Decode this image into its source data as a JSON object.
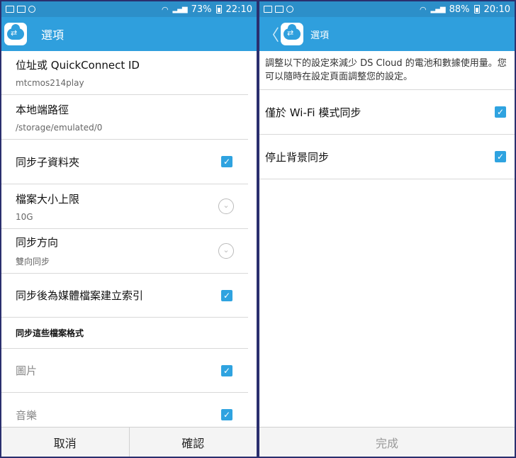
{
  "left": {
    "status": {
      "battery": "73%",
      "time": "22:10"
    },
    "appbar": {
      "title": "選項"
    },
    "items": [
      {
        "title": "位址或 QuickConnect ID",
        "sub": "mtcmos214play"
      },
      {
        "title": "本地端路徑",
        "sub": "/storage/emulated/0"
      },
      {
        "title": "同步子資料夾"
      },
      {
        "title": "檔案大小上限",
        "sub": "10G"
      },
      {
        "title": "同步方向",
        "sub": "雙向同步"
      },
      {
        "title": "同步後為媒體檔案建立索引"
      }
    ],
    "section_header": "同步這些檔案格式",
    "format_items": [
      {
        "title": "圖片"
      },
      {
        "title": "音樂"
      }
    ],
    "footer": {
      "cancel": "取消",
      "confirm": "確認"
    }
  },
  "right": {
    "status": {
      "battery": "88%",
      "time": "20:10"
    },
    "appbar": {
      "title": "選項"
    },
    "description": "調整以下的設定來減少 DS Cloud 的電池和數據使用量。您可以隨時在設定頁面調整您的設定。",
    "items": [
      {
        "title": "僅於 Wi-Fi 模式同步"
      },
      {
        "title": "停止背景同步"
      }
    ],
    "footer": {
      "done": "完成"
    }
  },
  "colors": {
    "accent": "#2f9fdd",
    "statusbar": "#2c8fc9",
    "checkbox": "#2fa3e0"
  },
  "icons": {
    "check": "✓",
    "chevron_down": "⌄",
    "back": "〈"
  }
}
